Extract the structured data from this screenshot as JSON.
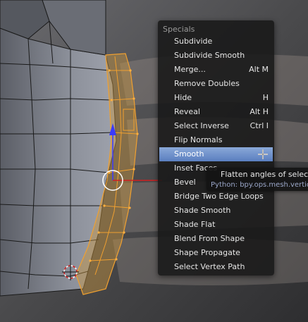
{
  "menu": {
    "title": "Specials",
    "items": [
      {
        "label": "Subdivide",
        "shortcut": ""
      },
      {
        "label": "Subdivide Smooth",
        "shortcut": ""
      },
      {
        "label": "Merge...",
        "shortcut": "Alt M"
      },
      {
        "label": "Remove Doubles",
        "shortcut": ""
      },
      {
        "label": "Hide",
        "shortcut": "H"
      },
      {
        "label": "Reveal",
        "shortcut": "Alt H"
      },
      {
        "label": "Select Inverse",
        "shortcut": "Ctrl I"
      },
      {
        "label": "Flip Normals",
        "shortcut": ""
      },
      {
        "label": "Smooth",
        "shortcut": ""
      },
      {
        "label": "Inset Faces",
        "shortcut": ""
      },
      {
        "label": "Bevel",
        "shortcut": ""
      },
      {
        "label": "Bridge Two Edge Loops",
        "shortcut": ""
      },
      {
        "label": "Shade Smooth",
        "shortcut": ""
      },
      {
        "label": "Shade Flat",
        "shortcut": ""
      },
      {
        "label": "Blend From Shape",
        "shortcut": ""
      },
      {
        "label": "Shape Propagate",
        "shortcut": ""
      },
      {
        "label": "Select Vertex Path",
        "shortcut": ""
      }
    ],
    "active_item": "Smooth"
  },
  "tooltip": {
    "description": "Flatten angles of selected",
    "python": "Python: bpy.ops.mesh.vertic"
  },
  "colors": {
    "selection": "#f0a030",
    "menu_highlight": "#5a7fc0",
    "mesh_face": "#8a8e98",
    "background": "#3a3a3a"
  }
}
